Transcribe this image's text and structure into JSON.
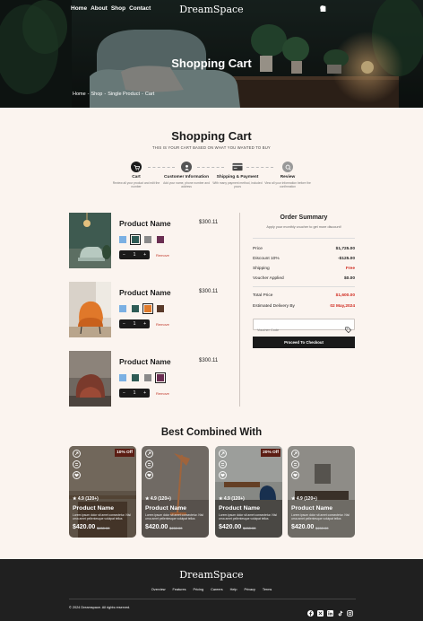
{
  "header": {
    "nav": [
      "Home",
      "About",
      "Shop",
      "Contact"
    ],
    "logo": "DreamSpace",
    "icons": [
      "search-icon",
      "chat-icon",
      "bag-icon",
      "user-icon"
    ]
  },
  "hero": {
    "title": "Shopping Cart",
    "breadcrumb": [
      "Home",
      "-",
      "Shop",
      "-",
      "Single Product",
      "-",
      "Cart"
    ]
  },
  "cart": {
    "title": "Shopping Cart",
    "subtitle": "THIS IS YOUR CART BASED ON WHAT YOU WANTED TO BUY",
    "steps": [
      {
        "label": "Cart",
        "desc": "Review all your product and edit the number",
        "icon": "cart-icon",
        "active": true
      },
      {
        "label": "Customer Information",
        "desc": "Add your name, phone number and address",
        "icon": "customer-icon",
        "active": true
      },
      {
        "label": "Shipping & Payment",
        "desc": "With many payment method, included yours",
        "icon": "card-icon",
        "active": true
      },
      {
        "label": "Review",
        "desc": "View all your information before the confirmation",
        "icon": "review-icon",
        "active": false
      }
    ],
    "items": [
      {
        "name": "Product Name",
        "price": "$300.11",
        "qty": "1",
        "remove": "Remove",
        "swatches": [
          "#7bb0e3",
          "#2e5b55",
          "#8a8a8a",
          "#6a2e52"
        ],
        "selected": 1
      },
      {
        "name": "Product Name",
        "price": "$300.11",
        "qty": "1",
        "remove": "Remove",
        "swatches": [
          "#7bb0e3",
          "#2e5b55",
          "#e07a2a",
          "#5a3a2a"
        ],
        "selected": 2
      },
      {
        "name": "Product Name",
        "price": "$300.11",
        "qty": "1",
        "remove": "Remove",
        "swatches": [
          "#7bb0e3",
          "#2e5b55",
          "#8a8a8a",
          "#6a2e52"
        ],
        "selected": 3
      }
    ],
    "stepper": {
      "minus": "−",
      "plus": "+"
    }
  },
  "summary": {
    "title": "Order Summary",
    "subtitle": "Apply your monthly voucher to get more discount!",
    "rows": [
      {
        "label": "Price",
        "value": "$1,725.00"
      },
      {
        "label": "Discount 10%",
        "value": "-$125.00"
      },
      {
        "label": "Shipping",
        "value": "Free"
      },
      {
        "label": "Voucher Applied",
        "value": "$0.00"
      }
    ],
    "total": {
      "label": "Total Price",
      "value": "$1,600.00"
    },
    "delivery": {
      "label": "Estimated Delivery By",
      "value": "02 May,2024"
    },
    "voucher_placeholder": "Voucher Code",
    "checkout": "Proceed To Checkout"
  },
  "combined": {
    "title": "Best Combined With",
    "cards": [
      {
        "badge": "10% Off",
        "rating": "4.9 (120+)",
        "name": "Product Name",
        "desc": "Lorem ipsum dolor sit amet consectetur. Nisl urna amet pellentesque volutpat tellus",
        "price": "$420.00",
        "old": "$450.00"
      },
      {
        "badge": "",
        "rating": "4.9 (120+)",
        "name": "Product Name",
        "desc": "Lorem ipsum dolor sit amet consectetur. Nisl urna amet pellentesque volutpat tellus",
        "price": "$420.00",
        "old": "$450.00"
      },
      {
        "badge": "20% Off",
        "rating": "4.9 (120+)",
        "name": "Product Name",
        "desc": "Lorem ipsum dolor sit amet consectetur. Nisl urna amet pellentesque volutpat tellus",
        "price": "$420.00",
        "old": "$450.00"
      },
      {
        "badge": "",
        "rating": "4.9 (120+)",
        "name": "Product Name",
        "desc": "Lorem ipsum dolor sit amet consectetur. Nisl urna amet pellentesque volutpat tellus",
        "price": "$420.00",
        "old": "$450.00"
      }
    ]
  },
  "footer": {
    "logo": "DreamSpace",
    "links": [
      "Overview",
      "Features",
      "Pricing",
      "Careers",
      "Help",
      "Privacy",
      "Terms"
    ],
    "copyright": "© 2024 Dreamspace. All rights reserved.",
    "social": [
      "facebook-icon",
      "twitter-icon",
      "linkedin-icon",
      "tiktok-icon",
      "instagram-icon"
    ]
  },
  "colors": {
    "accent": "#1a1a1a",
    "danger": "#d02b20",
    "background": "#fbf4ef",
    "badge": "#5b1d13"
  }
}
